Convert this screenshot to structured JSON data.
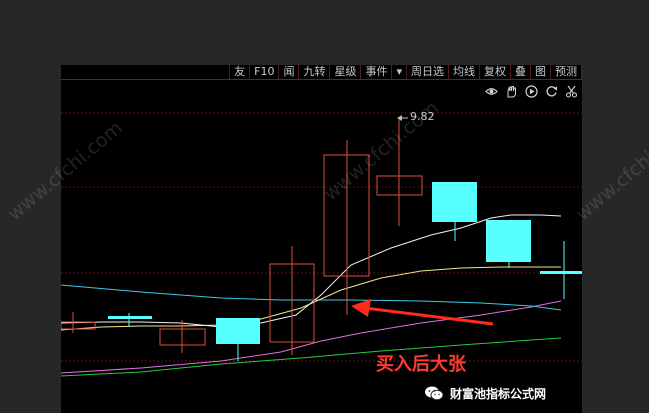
{
  "toolbar": {
    "items": [
      "友",
      "F10",
      "闻",
      "九转",
      "星级",
      "事件",
      "▾",
      "周日选",
      "均线",
      "复权",
      "叠",
      "图",
      "预测"
    ]
  },
  "icons": [
    "eye-icon",
    "hand-icon",
    "play-icon",
    "refresh-icon",
    "scissors-icon"
  ],
  "chart": {
    "high_label": "9.82",
    "candles": [
      {
        "dir": "down",
        "body_color": "#e0503c"
      },
      {
        "dir": "up",
        "body_color": "#58ffff"
      },
      {
        "dir": "down",
        "body_color": "#e0503c"
      },
      {
        "dir": "up",
        "body_color": "#58ffff"
      },
      {
        "dir": "down",
        "body_color": "#e0503c"
      },
      {
        "dir": "down",
        "body_color": "#e0503c"
      },
      {
        "dir": "down",
        "body_color": "#e0503c"
      },
      {
        "dir": "up",
        "body_color": "#58ffff"
      },
      {
        "dir": "up",
        "body_color": "#58ffff"
      },
      {
        "dir": "up",
        "body_color": "#58ffff"
      }
    ],
    "line_colors": {
      "ma_white": "#f2f2f2",
      "ma_yellow": "#f0e68c",
      "ma_cyan": "#3cc8e8",
      "ma_magenta": "#e070e0",
      "ma_green": "#27c93f"
    },
    "annotation_arrow_color": "#ff2a1a"
  },
  "watermark": "www.cfchi.com",
  "annotation": "买入后大张",
  "footer": {
    "brand": "财富池指标公式网",
    "logo_icon": "wechat-icon"
  }
}
